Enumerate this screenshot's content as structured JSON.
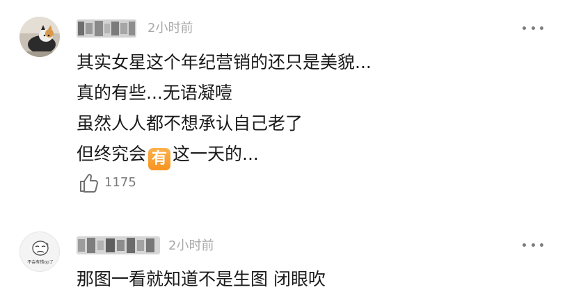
{
  "comments": [
    {
      "username": "",
      "time": "2小时前",
      "lines": [
        "其实女星这个年纪营销的还只是美貌...",
        "真的有些...无语凝噎",
        "虽然人人都不想承认自己老了"
      ],
      "last_line_before": "但终究会",
      "emoji_char": "有",
      "last_line_after": "这一天的...",
      "likes": "1175",
      "avatar_icon": "cat-photo-icon"
    },
    {
      "username": "",
      "time": "2小时前",
      "text": "那图一看就知道不是生图 闭眼吹",
      "avatar_caption": "不会有错op了",
      "avatar_icon": "sad-face-sticker-icon"
    }
  ],
  "icons": {
    "more": "more-horizontal-icon",
    "like": "thumbs-up-icon"
  }
}
